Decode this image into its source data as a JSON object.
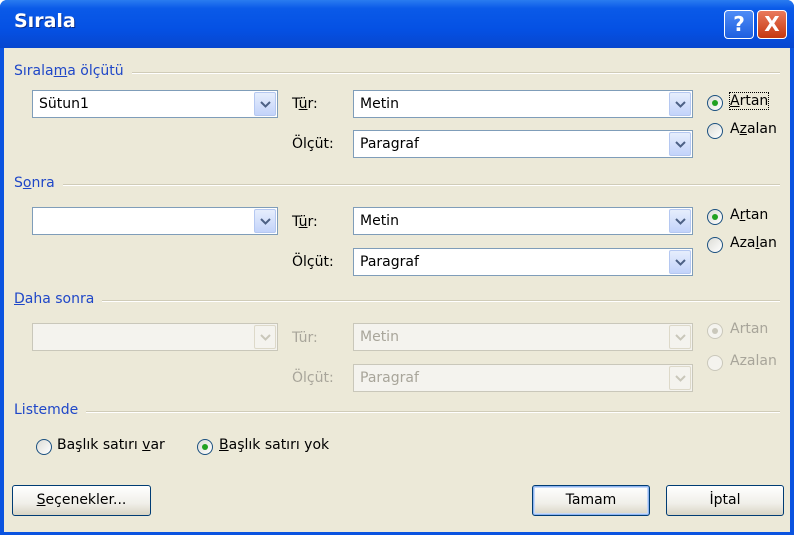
{
  "window": {
    "title": "Sırala",
    "help_label": "?",
    "close_label": "X"
  },
  "sort_by": {
    "section_label": {
      "pre": "Sırala",
      "u": "m",
      "post": "a ölçütü"
    },
    "column": "Sütun1",
    "type_label": {
      "pre": "T",
      "u": "ü",
      "post": "r:"
    },
    "type_value": "Metin",
    "using_label": "Ölçüt:",
    "using_value": "Paragraf",
    "ascending": {
      "u": "A",
      "post": "rtan"
    },
    "descending": {
      "pre": "A",
      "u": "z",
      "post": "alan"
    },
    "selected": "ascending"
  },
  "then_by": {
    "section_label": {
      "pre": "S",
      "u": "o",
      "post": "nra"
    },
    "column": "",
    "type_label": {
      "pre": "T",
      "u": "ü",
      "post": "r:"
    },
    "type_value": "Metin",
    "using_label": "Ölçüt:",
    "using_value": "Paragraf",
    "ascending": {
      "pre": "A",
      "u": "r",
      "post": "tan"
    },
    "descending": {
      "pre": "Aza",
      "u": "l",
      "post": "an"
    },
    "selected": "ascending"
  },
  "then_by_2": {
    "section_label": {
      "u": "D",
      "post": "aha sonra"
    },
    "column": "",
    "type_label": "Tür:",
    "type_value": "Metin",
    "using_label": "Ölçüt:",
    "using_value": "Paragraf",
    "ascending": "Artan",
    "descending": "Azalan",
    "enabled": false
  },
  "my_list": {
    "section_label": "Listemde",
    "header_row": {
      "pre": "Başlık satırı ",
      "u": "v",
      "post": "ar"
    },
    "no_header_row": {
      "u": "B",
      "post": "aşlık satırı yok"
    },
    "selected": "no_header_row"
  },
  "buttons": {
    "options": {
      "u": "S",
      "post": "eçenekler..."
    },
    "ok": "Tamam",
    "cancel": "İptal"
  },
  "colors": {
    "titlebar": "#0551e4",
    "dialog_bg": "#ECE9D8",
    "section_label": "#1f47c8",
    "radio_dot": "#21a121"
  }
}
